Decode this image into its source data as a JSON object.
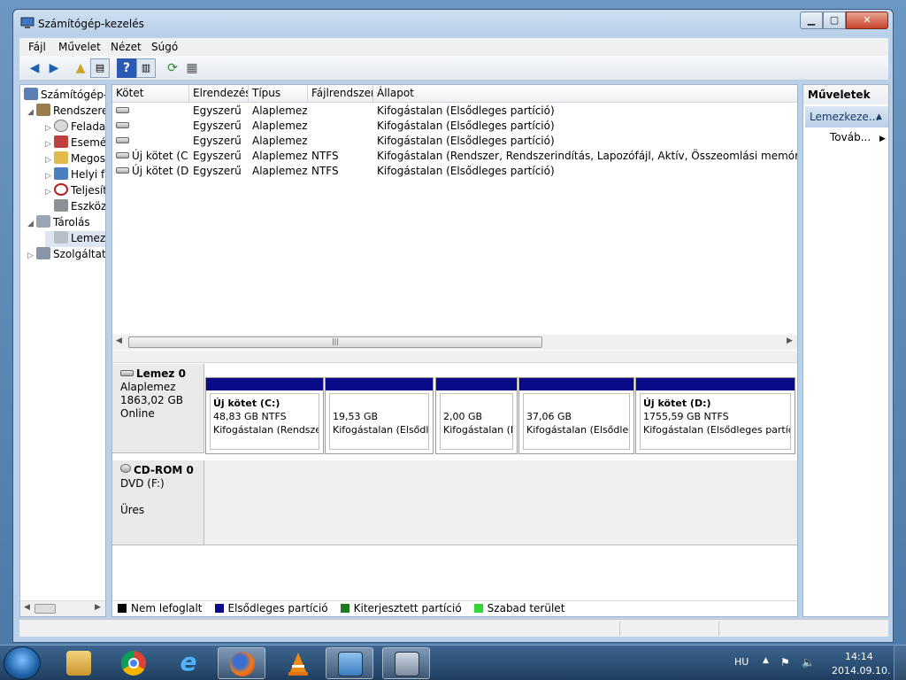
{
  "window": {
    "title": "Számítógép-kezelés"
  },
  "menubar": {
    "items": [
      "Fájl",
      "Művelet",
      "Nézet",
      "Súgó"
    ]
  },
  "toolbar": {
    "icons": [
      "back-arrow-icon",
      "forward-arrow-icon",
      "up-folder-icon",
      "show-hide-tree-icon",
      "help-icon",
      "console-view-icon",
      "refresh-icon",
      "properties-icon"
    ]
  },
  "tree": {
    "items": [
      {
        "label": "Számítógép-kezelés (Helyi)",
        "indent": 0,
        "toggle": "",
        "icon": "computer-icon"
      },
      {
        "label": "Rendszereszközök",
        "indent": 1,
        "toggle": "◢",
        "icon": "tools-icon"
      },
      {
        "label": "Feladatütemező",
        "indent": 2,
        "toggle": "▷",
        "icon": "clock-icon"
      },
      {
        "label": "Eseménynapló",
        "indent": 2,
        "toggle": "▷",
        "icon": "event-log-icon"
      },
      {
        "label": "Megosztott mappák",
        "indent": 2,
        "toggle": "▷",
        "icon": "shared-folder-icon"
      },
      {
        "label": "Helyi felhasználók és csoportok",
        "indent": 2,
        "toggle": "▷",
        "icon": "users-icon"
      },
      {
        "label": "Teljesítmény",
        "indent": 2,
        "toggle": "▷",
        "icon": "performance-icon"
      },
      {
        "label": "Eszközkezelő",
        "indent": 2,
        "toggle": "",
        "icon": "device-manager-icon"
      },
      {
        "label": "Tárolás",
        "indent": 1,
        "toggle": "◢",
        "icon": "storage-icon"
      },
      {
        "label": "Lemezkezelés",
        "indent": 2,
        "toggle": "",
        "icon": "disk-management-icon"
      },
      {
        "label": "Szolgáltatások és alkalmazások",
        "indent": 1,
        "toggle": "▷",
        "icon": "services-icon"
      }
    ]
  },
  "volumes": {
    "columns": [
      "Kötet",
      "Elrendezés",
      "Típus",
      "Fájlrendszer",
      "Állapot"
    ],
    "rows": [
      {
        "volume": "",
        "layout": "Egyszerű",
        "type": "Alaplemez",
        "fs": "",
        "status": "Kifogástalan (Elsődleges partíció)"
      },
      {
        "volume": "",
        "layout": "Egyszerű",
        "type": "Alaplemez",
        "fs": "",
        "status": "Kifogástalan (Elsődleges partíció)"
      },
      {
        "volume": "",
        "layout": "Egyszerű",
        "type": "Alaplemez",
        "fs": "",
        "status": "Kifogástalan (Elsődleges partíció)"
      },
      {
        "volume": "Új kötet (C:)",
        "layout": "Egyszerű",
        "type": "Alaplemez",
        "fs": "NTFS",
        "status": "Kifogástalan (Rendszer, Rendszerindítás, Lapozófájl, Aktív, Összeomlási memóriakép, Elsőd"
      },
      {
        "volume": "Új kötet (D:)",
        "layout": "Egyszerű",
        "type": "Alaplemez",
        "fs": "NTFS",
        "status": "Kifogástalan (Elsődleges partíció)"
      }
    ]
  },
  "disks": {
    "disk0": {
      "name": "Lemez 0",
      "type": "Alaplemez",
      "size": "1863,02 GB",
      "state": "Online",
      "partitions": [
        {
          "name": "Új kötet  (C:)",
          "size": "48,83 GB NTFS",
          "status": "Kifogástalan (Rendszer"
        },
        {
          "name": "",
          "size": "19,53 GB",
          "status": "Kifogástalan (Elsődle"
        },
        {
          "name": "",
          "size": "2,00 GB",
          "status": "Kifogástalan (E"
        },
        {
          "name": "",
          "size": "37,06 GB",
          "status": "Kifogástalan (Elsődleg"
        },
        {
          "name": "Új kötet  (D:)",
          "size": "1755,59 GB NTFS",
          "status": "Kifogástalan (Elsődleges partíci"
        }
      ]
    },
    "cdrom0": {
      "name": "CD-ROM 0",
      "type": "DVD (F:)",
      "state": "Üres"
    }
  },
  "legend": {
    "items": [
      {
        "label": "Nem lefoglalt",
        "color": "#000000"
      },
      {
        "label": "Elsődleges partíció",
        "color": "#0b0b8a"
      },
      {
        "label": "Kiterjesztett partíció",
        "color": "#1e7a1e"
      },
      {
        "label": "Szabad terület",
        "color": "#33d633"
      }
    ]
  },
  "actions": {
    "header": "Műveletek",
    "section": "Lemezkeze...",
    "item": "Továb..."
  },
  "taskbar": {
    "apps": [
      "file-explorer-icon",
      "chrome-icon",
      "internet-explorer-icon",
      "firefox-icon",
      "vlc-icon",
      "control-panel-icon",
      "computer-management-icon"
    ],
    "language": "HU",
    "time": "14:14",
    "date": "2014.09.10."
  },
  "colors": {
    "primary_partition": "#0b0b8a",
    "window_frame": "#b9d1ea",
    "taskbar": "#1f3e5f"
  }
}
